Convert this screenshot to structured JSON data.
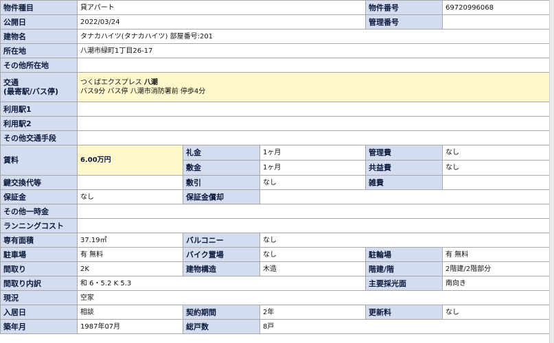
{
  "rows": {
    "property_type": {
      "label": "物件種目",
      "value": "貸アパート"
    },
    "property_number": {
      "label": "物件番号",
      "value": "69720996068"
    },
    "published": {
      "label": "公開日",
      "value": "2022/03/24"
    },
    "management_number": {
      "label": "管理番号",
      "value": ""
    },
    "building_name": {
      "label": "建物名",
      "value": "タナカハイツ(タナカハイツ) 部屋番号:201"
    },
    "address": {
      "label": "所在地",
      "value": "八潮市緑町1丁目26-17"
    },
    "other_address": {
      "label": "その他所在地",
      "value": ""
    },
    "transport": {
      "label_line1": "交通",
      "label_line2": "(最寄駅/バス停)",
      "line_name": "つくばエクスプレス",
      "station": "八潮",
      "detail": "バス9分 バス停 八潮市消防署前 停歩4分"
    },
    "station1": {
      "label": "利用駅1",
      "value": ""
    },
    "station2": {
      "label": "利用駅2",
      "value": ""
    },
    "other_transport": {
      "label": "その他交通手段",
      "value": ""
    },
    "rent": {
      "label": "賃料",
      "value": "6.00万円"
    },
    "key_money": {
      "label": "礼金",
      "value": "1ヶ月"
    },
    "management_fee": {
      "label": "管理費",
      "value": "なし"
    },
    "deposit": {
      "label": "敷金",
      "value": "1ヶ月"
    },
    "common_fee": {
      "label": "共益費",
      "value": "なし"
    },
    "key_exchange": {
      "label": "鍵交換代等",
      "value": ""
    },
    "deduction": {
      "label": "敷引",
      "value": "なし"
    },
    "misc_fee": {
      "label": "雑費",
      "value": ""
    },
    "guarantee": {
      "label": "保証金",
      "value": "なし"
    },
    "guarantee_amortization": {
      "label": "保証金償却",
      "value": ""
    },
    "other_onetime": {
      "label": "その他一時金",
      "value": ""
    },
    "running_cost": {
      "label": "ランニングコスト",
      "value": ""
    },
    "floor_area": {
      "label": "専有面積",
      "value": "37.19㎡"
    },
    "balcony": {
      "label": "バルコニー",
      "value": "なし"
    },
    "parking": {
      "label": "駐車場",
      "value": "有 無料"
    },
    "bike_parking": {
      "label": "バイク置場",
      "value": "なし"
    },
    "bicycle_parking": {
      "label": "駐輪場",
      "value": "有 無料"
    },
    "layout": {
      "label": "間取り",
      "value": "2K"
    },
    "structure": {
      "label": "建物構造",
      "value": "木造"
    },
    "floors": {
      "label": "階建/階",
      "value": "2階建/2階部分"
    },
    "layout_detail": {
      "label": "間取り内訳",
      "value": "和 6・5.2 K 5.3"
    },
    "main_light": {
      "label": "主要採光面",
      "value": "南向き"
    },
    "status": {
      "label": "現況",
      "value": "空家"
    },
    "move_in": {
      "label": "入居日",
      "value": "相談"
    },
    "contract_period": {
      "label": "契約期間",
      "value": "2年"
    },
    "renewal_fee": {
      "label": "更新料",
      "value": "なし"
    },
    "built": {
      "label": "築年月",
      "value": "1987年07月"
    },
    "total_units": {
      "label": "総戸数",
      "value": "8戸"
    }
  }
}
